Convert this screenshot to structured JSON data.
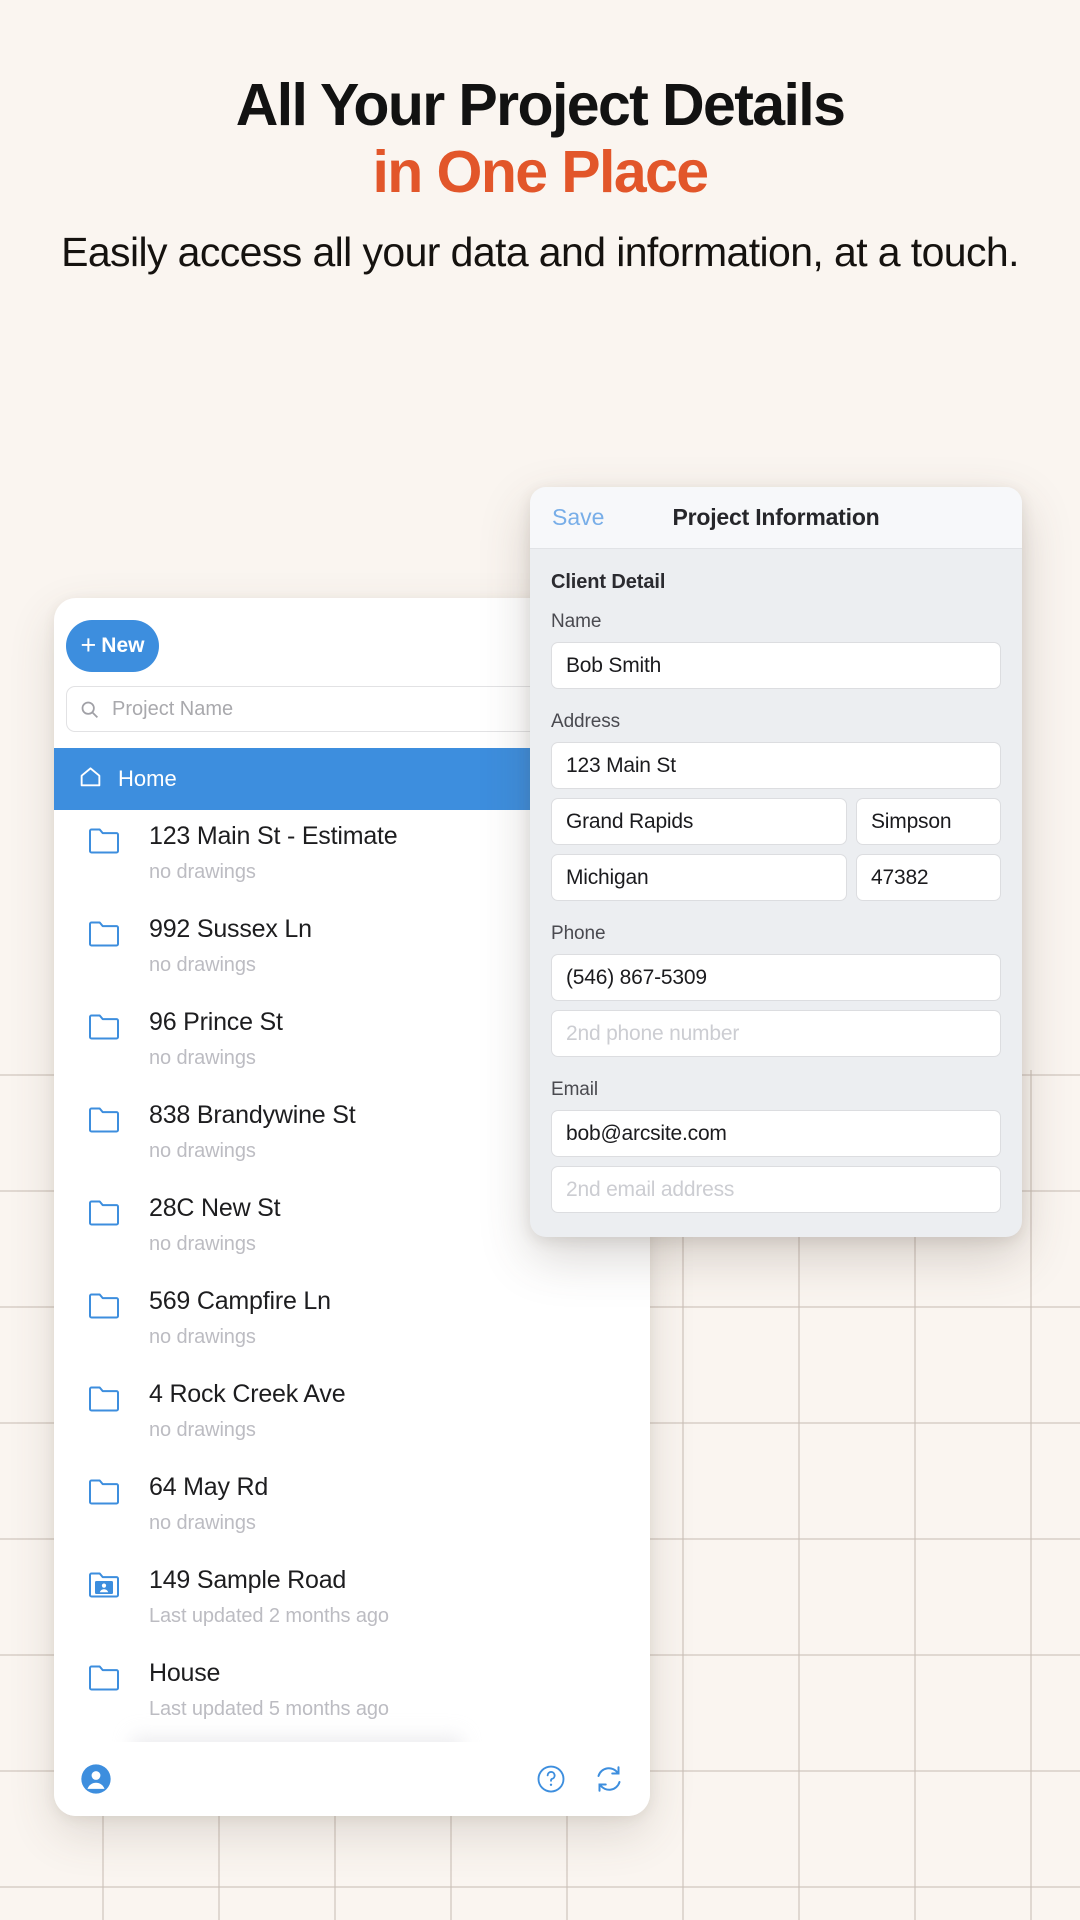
{
  "hero": {
    "title_line1": "All Your Project Details",
    "title_line2": "in One Place",
    "subtitle": "Easily access all your data and information, at a touch.",
    "accent_color": "#e2562a"
  },
  "projects_panel": {
    "new_button_label": "New",
    "new_button_plus": "+",
    "search_placeholder": "Project Name",
    "home_label": "Home",
    "accent_color": "#3d8ede",
    "items": [
      {
        "title": "123 Main St - Estimate",
        "subtitle": "no drawings",
        "icon": "folder-icon"
      },
      {
        "title": "992 Sussex Ln",
        "subtitle": "no drawings",
        "icon": "folder-icon"
      },
      {
        "title": "96 Prince St",
        "subtitle": "no drawings",
        "icon": "folder-icon"
      },
      {
        "title": "838 Brandywine St",
        "subtitle": "no drawings",
        "icon": "folder-icon"
      },
      {
        "title": "28C New St",
        "subtitle": "no drawings",
        "icon": "folder-icon"
      },
      {
        "title": "569 Campfire Ln",
        "subtitle": "no drawings",
        "icon": "folder-icon"
      },
      {
        "title": "4 Rock Creek Ave",
        "subtitle": "no drawings",
        "icon": "folder-icon"
      },
      {
        "title": "64 May Rd",
        "subtitle": "no drawings",
        "icon": "folder-icon"
      },
      {
        "title": "149 Sample Road",
        "subtitle": "Last updated 2 months ago",
        "icon": "folder-shared-icon"
      },
      {
        "title": "House",
        "subtitle": "Last updated 5 months ago",
        "icon": "folder-icon"
      }
    ],
    "footer": {
      "account_icon": "account-circle-icon",
      "help_icon": "help-circle-icon",
      "sync_icon": "sync-refresh-icon"
    }
  },
  "info_panel": {
    "save_label": "Save",
    "title": "Project Information",
    "section_title": "Client Detail",
    "labels": {
      "name": "Name",
      "address": "Address",
      "phone": "Phone",
      "email": "Email"
    },
    "values": {
      "name": "Bob Smith",
      "street": "123 Main St",
      "city": "Grand Rapids",
      "county": "Simpson",
      "state": "Michigan",
      "zip": "47382",
      "phone1": "(546) 867-5309",
      "email1": "bob@arcsite.com"
    },
    "placeholders": {
      "phone2": "2nd phone number",
      "email2": "2nd email address"
    }
  }
}
